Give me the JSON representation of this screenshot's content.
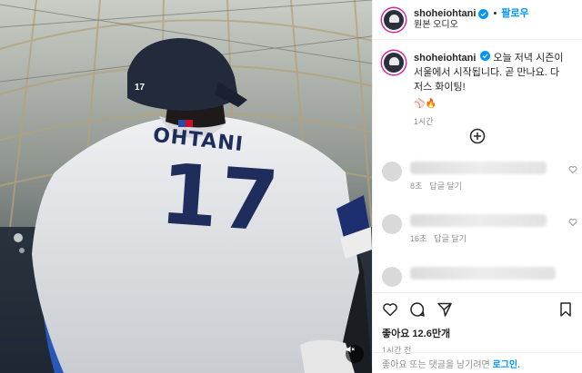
{
  "post": {
    "username": "shoheiohtani",
    "follow_label": "팔로우",
    "separator": "•",
    "audio_label": "원본 오디오",
    "caption": "오늘 저녁 시즌이 서울에서 시작됩니다. 곧 만나요. 다저스 화이팅!",
    "caption_emojis": "⚾🔥",
    "caption_time": "1시간",
    "likes": "좋아요 12.6만개",
    "posted_ago": "1시간 전"
  },
  "media": {
    "jersey_name": "OHTANI",
    "jersey_number": "17",
    "helmet_number": "17"
  },
  "comments": [
    {
      "time": "8초",
      "reply_label": "답글 달기"
    },
    {
      "time": "16초",
      "reply_label": "답글 달기"
    },
    {
      "time": "",
      "reply_label": ""
    }
  ],
  "login_prompt": {
    "text": "좋아요 또는 댓글을 남기려면",
    "link": "로그인."
  },
  "icons": {
    "verified": "verified-badge-icon",
    "add": "add-circle-icon",
    "like": "heart-icon",
    "comment": "comment-bubble-icon",
    "share": "paper-plane-icon",
    "save": "bookmark-icon",
    "mute": "speaker-muted-icon"
  },
  "colors": {
    "accent": "#0095f6",
    "jersey_text": "#1f2d5c",
    "story_ring": "#d6249f"
  }
}
